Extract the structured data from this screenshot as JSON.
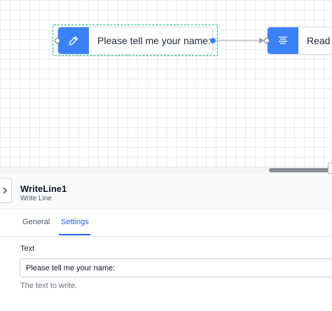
{
  "canvas": {
    "nodes": [
      {
        "label": "Please tell me your name:",
        "icon": "pencil-icon",
        "accent": "#3b82f6",
        "selected": true
      },
      {
        "label": "Read L",
        "icon": "text-lines-icon",
        "accent": "#3b82f6",
        "selected": false
      }
    ],
    "selection_color": "#10b981"
  },
  "panel": {
    "title": "WriteLine1",
    "subtitle": "Write Line",
    "tabs": [
      {
        "label": "General",
        "active": false
      },
      {
        "label": "Settings",
        "active": true
      }
    ],
    "active_color": "#2563eb",
    "field": {
      "label": "Text",
      "value": "Please tell me your name:",
      "help": "The text to write."
    }
  }
}
